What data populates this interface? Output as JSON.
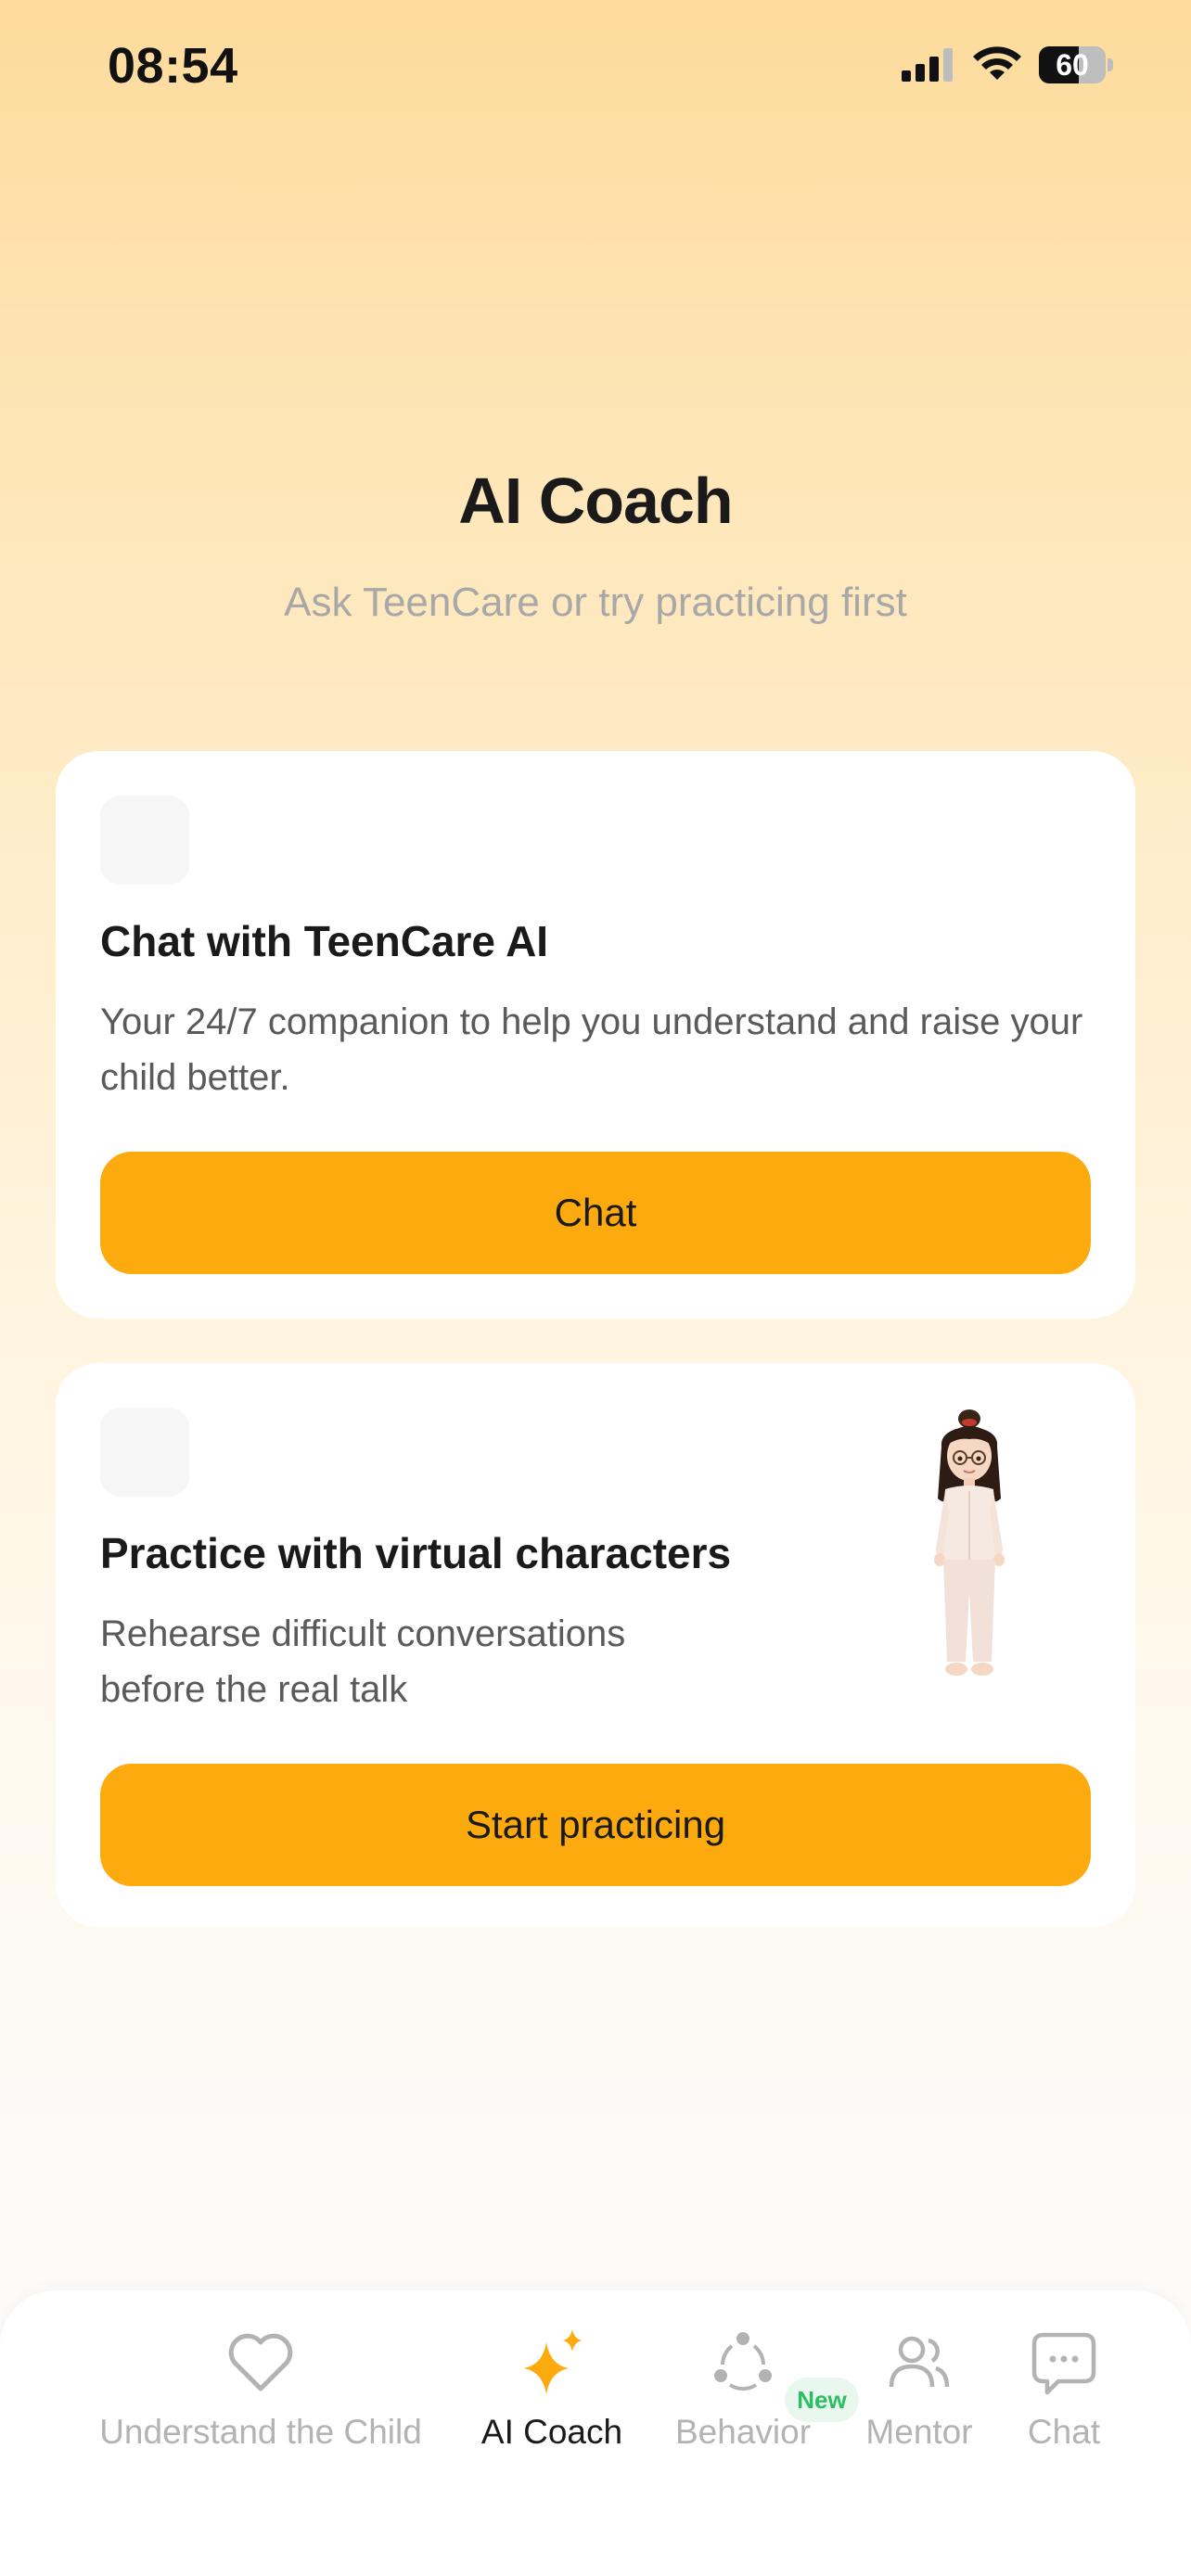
{
  "status_bar": {
    "time": "08:54",
    "battery_level": "60",
    "battery_fraction": 0.6,
    "icons": [
      "signal-icon",
      "wifi-icon",
      "battery-icon"
    ]
  },
  "header": {
    "title": "AI Coach",
    "subtitle": "Ask TeenCare or try practicing first"
  },
  "cards": [
    {
      "title": "Chat with TeenCare AI",
      "description": "Your 24/7 companion to help you understand and raise your child better.",
      "button_label": "Chat"
    },
    {
      "title": "Practice with virtual characters",
      "description": "Rehearse difficult conversations before the real talk",
      "button_label": "Start practicing",
      "image": "virtual-character-girl"
    }
  ],
  "bottom_nav": {
    "items": [
      {
        "label": "Understand the Child",
        "icon": "heart-icon",
        "active": false
      },
      {
        "label": "AI Coach",
        "icon": "sparkle-icon",
        "active": true
      },
      {
        "label": "Behavior",
        "icon": "behavior-cycle-icon",
        "active": false,
        "badge": "New"
      },
      {
        "label": "Mentor",
        "icon": "people-icon",
        "active": false
      },
      {
        "label": "Chat",
        "icon": "chat-bubble-icon",
        "active": false
      }
    ]
  },
  "colors": {
    "accent": "#FDAA0F",
    "background_top": "#FDDB9C",
    "text_primary": "#1A1A1A",
    "text_secondary": "#5A5A5A",
    "text_muted": "#A8A8A8",
    "nav_inactive": "#B3B3B3",
    "badge_text": "#2DBE64"
  }
}
